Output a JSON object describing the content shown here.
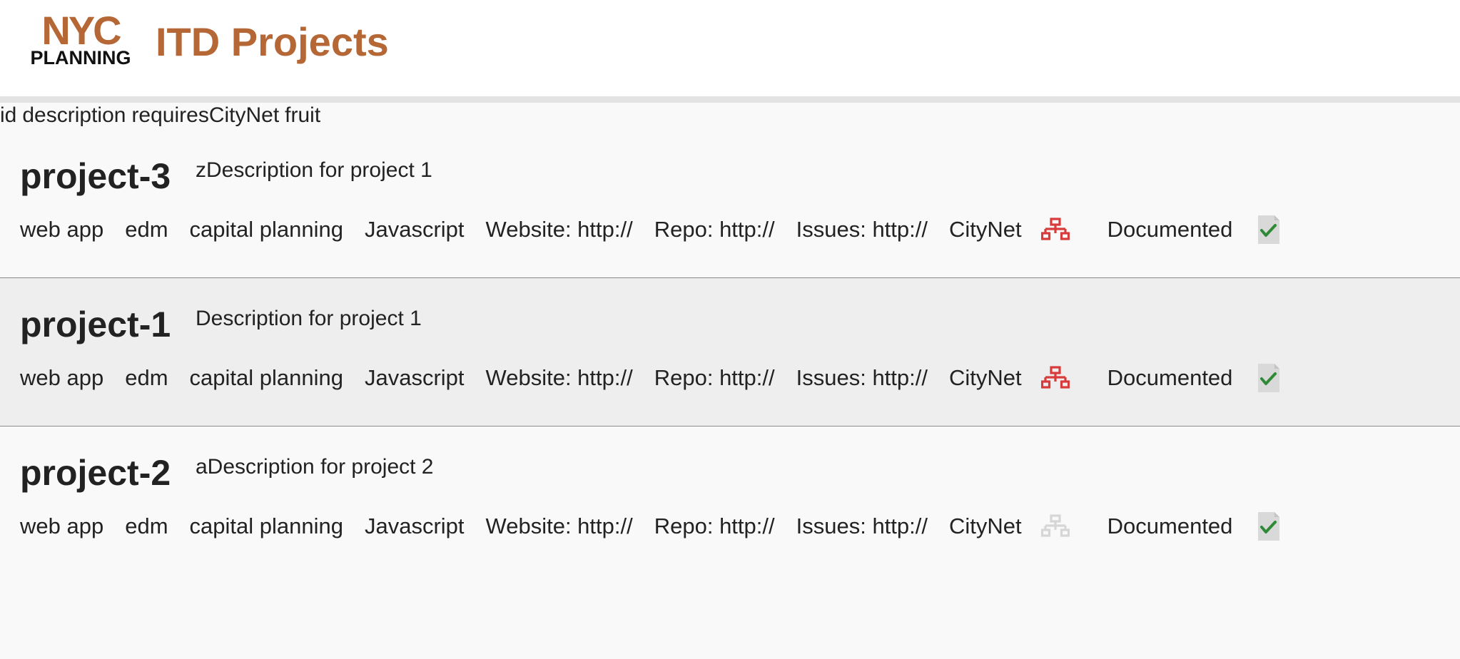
{
  "header": {
    "logo_top": "NYC",
    "logo_bottom": "PLANNING",
    "title": "ITD Projects",
    "brand_color": "#b56735"
  },
  "sort_fields": [
    "id",
    "description",
    "requiresCityNet",
    "fruit"
  ],
  "projects": [
    {
      "id": "project-3",
      "description": "zDescription for project 1",
      "tags": [
        "web app",
        "edm",
        "capital planning",
        "Javascript"
      ],
      "website": "Website: http://",
      "repo": "Repo: http://",
      "issues": "Issues: http://",
      "citynet_label": "CityNet",
      "requires_citynet": true,
      "documented_label": "Documented",
      "documented": true,
      "highlighted": false
    },
    {
      "id": "project-1",
      "description": "Description for project 1",
      "tags": [
        "web app",
        "edm",
        "capital planning",
        "Javascript"
      ],
      "website": "Website: http://",
      "repo": "Repo: http://",
      "issues": "Issues: http://",
      "citynet_label": "CityNet",
      "requires_citynet": true,
      "documented_label": "Documented",
      "documented": true,
      "highlighted": true
    },
    {
      "id": "project-2",
      "description": "aDescription for project 2",
      "tags": [
        "web app",
        "edm",
        "capital planning",
        "Javascript"
      ],
      "website": "Website: http://",
      "repo": "Repo: http://",
      "issues": "Issues: http://",
      "citynet_label": "CityNet",
      "requires_citynet": false,
      "documented_label": "Documented",
      "documented": true,
      "highlighted": false
    }
  ],
  "icons": {
    "network": "network-icon",
    "document_check": "document-check-icon"
  },
  "colors": {
    "citynet_on": "#d93b3b",
    "citynet_off": "#d6d6d6",
    "check": "#2f8a35",
    "doc": "#d9d9d9"
  }
}
